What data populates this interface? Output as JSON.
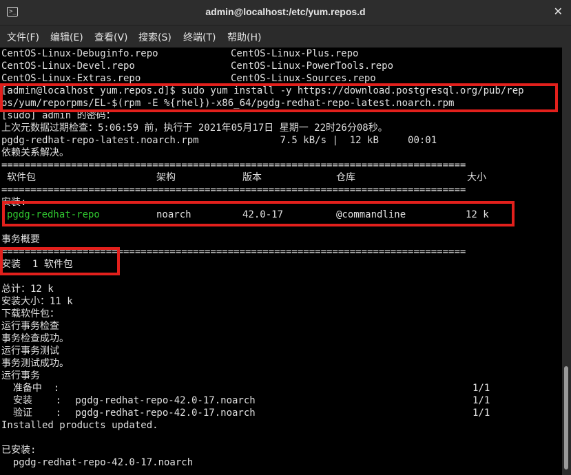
{
  "window": {
    "title": "admin@localhost:/etc/yum.repos.d"
  },
  "menu": [
    "文件(F)",
    "编辑(E)",
    "查看(V)",
    "搜索(S)",
    "终端(T)",
    "帮助(H)"
  ],
  "terminal": {
    "repo_rows": [
      [
        "CentOS-Linux-Debuginfo.repo",
        "CentOS-Linux-Plus.repo"
      ],
      [
        "CentOS-Linux-Devel.repo",
        "CentOS-Linux-PowerTools.repo"
      ],
      [
        "CentOS-Linux-Extras.repo",
        "CentOS-Linux-Sources.repo"
      ]
    ],
    "cmd_line1": "[admin@localhost yum.repos.d]$ sudo yum install -y https://download.postgresql.org/pub/rep",
    "cmd_line2": "os/yum/reporpms/EL-$(rpm -E %{rhel})-x86_64/pgdg-redhat-repo-latest.noarch.rpm",
    "sudo_prompt": "[sudo] admin 的密码：",
    "metadata_check": "上次元数据过期检查：5:06:59 前，执行于 2021年05月17日 星期一 22时26分08秒。",
    "download_line": "pgdg-redhat-repo-latest.noarch.rpm              7.5 kB/s |  12 kB     00:01",
    "deps_resolved": "依赖关系解决。",
    "separator": "================================================================================",
    "table_headers": {
      "package": "软件包",
      "arch": "架构",
      "version": "版本",
      "repo": "仓库",
      "size": "大小"
    },
    "install_label": "安装:",
    "package_row": {
      "name": "pgdg-redhat-repo",
      "arch": "noarch",
      "version": "42.0-17",
      "repo": "@commandline",
      "size": "12 k"
    },
    "summary_title": "事务概要",
    "install_count": "安装  1 软件包",
    "total": "总计：12 k",
    "install_size": "安装大小：11 k",
    "downloading": "下载软件包：",
    "trans_check": "运行事务检查",
    "trans_check_ok": "事务检查成功。",
    "trans_test": "运行事务测试",
    "trans_test_ok": "事务测试成功。",
    "trans_run": "运行事务",
    "steps": [
      {
        "label": "  准备中  :",
        "detail": "",
        "progress": "1/1"
      },
      {
        "label": "  安装    :",
        "detail": " pgdg-redhat-repo-42.0-17.noarch",
        "progress": "1/1"
      },
      {
        "label": "  验证    :",
        "detail": " pgdg-redhat-repo-42.0-17.noarch",
        "progress": "1/1"
      }
    ],
    "products_updated": "Installed products updated.",
    "installed_label": "已安装:",
    "installed_pkg": "  pgdg-redhat-repo-42.0-17.noarch"
  },
  "colors": {
    "highlight_box": "#e2201c",
    "package_name": "#2fc62f",
    "terminal_bg": "#000000"
  }
}
